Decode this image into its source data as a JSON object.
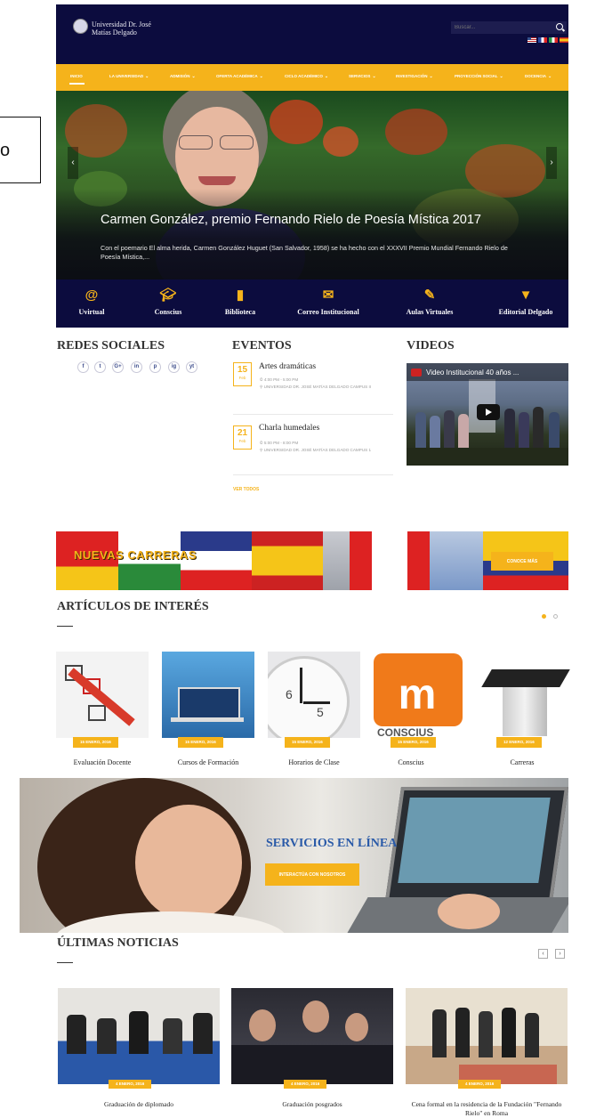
{
  "header": {
    "logo_line1": "Universidad Dr. José",
    "logo_line2": "Matías Delgado",
    "search_placeholder": "Buscar...",
    "flags": [
      "us-flag",
      "fr-flag",
      "it-flag",
      "es-flag"
    ]
  },
  "nav": {
    "items": [
      "INICIO",
      "LA UNIVERSIDAD",
      "ADMISIÓN",
      "OFERTA ACADÉMICA",
      "CICLO ACADÉMICO",
      "SERVICIOS",
      "INVESTIGACIÓN",
      "PROYECCIÓN SOCIAL",
      "DOCENCIA"
    ]
  },
  "hero": {
    "title": "Carmen González, premio Fernando Rielo de Poesía Mística 2017",
    "description": "Con el poemario El alma herida, Carmen González Huguet (San Salvador, 1958) se ha hecho con el XXXVII Premio Mundial Fernando Rielo de Poesía Mística,..."
  },
  "quick_links": [
    "Uvirtual",
    "Conscius",
    "Biblioteca",
    "Correo Institucional",
    "Aulas Virtuales",
    "Editorial Delgado"
  ],
  "social": {
    "title": "REDES SOCIALES",
    "icons": [
      "f",
      "t",
      "G+",
      "in",
      "p",
      "ig",
      "yt"
    ]
  },
  "events": {
    "title": "EVENTOS",
    "items": [
      {
        "day": "15",
        "month": "Feb",
        "title": "Artes dramáticas",
        "time": "⏲ 4:00 PM - 5:00 PM",
        "place": "⚲ UNIVERSIDAD DR. JOSÉ MATÍAS DELGADO CAMPUS II"
      },
      {
        "day": "21",
        "month": "Feb",
        "title": "Charla humedales",
        "time": "⏲ 5:00 PM - 8:00 PM",
        "place": "⚲ UNIVERSIDAD DR. JOSÉ MATÍAS DELGADO CAMPUS 1"
      }
    ],
    "view_all": "VER TODOS"
  },
  "videos": {
    "title": "VIDEOS",
    "video_title": "Video Institucional 40 años ..."
  },
  "careers": {
    "label": "NUEVAS CARRERAS",
    "button": "CONOCE MÁS"
  },
  "articles": {
    "title": "ARTÍCULOS DE INTERÉS",
    "items": [
      {
        "date": "15 ENERO, 2016",
        "caption": "Evaluación Docente"
      },
      {
        "date": "15 ENERO, 2016",
        "caption": "Cursos de Formación"
      },
      {
        "date": "15 ENERO, 2016",
        "caption": "Horarios de Clase"
      },
      {
        "date": "15 ENERO, 2016",
        "caption": "Conscius"
      },
      {
        "date": "12 ENERO, 2016",
        "caption": "Carreras"
      }
    ],
    "conscius_logo": "CONSCIUS"
  },
  "services": {
    "title": "SERVICIOS EN LÍNEA",
    "button": "INTERACTÚA CON NOSOTROS"
  },
  "news": {
    "title": "ÚLTIMAS NOTICIAS",
    "items": [
      {
        "date": "4 ENERO, 2016",
        "caption": "Graduación de diplomado"
      },
      {
        "date": "4 ENERO, 2016",
        "caption": "Graduación posgrados"
      },
      {
        "date": "4 ENERO, 2016",
        "caption": "Cena formal en la residencia de la Fundación \"Fernando Rielo\" en Roma"
      }
    ]
  },
  "edge_fragment": "o",
  "colors": {
    "navy": "#0c0c3e",
    "accent": "#f5b31b"
  }
}
